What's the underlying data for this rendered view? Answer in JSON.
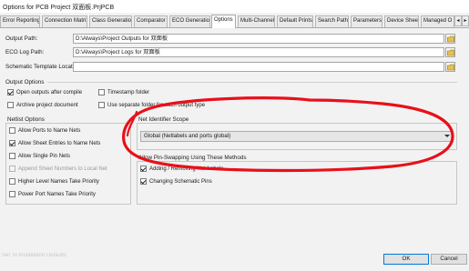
{
  "window": {
    "title": "Options for PCB Project 双面板.PrjPCB"
  },
  "tabs": [
    "Error Reporting",
    "Connection Matrix",
    "Class Generation",
    "Comparator",
    "ECO Generation",
    "Options",
    "Multi-Channel",
    "Default Prints",
    "Search Paths",
    "Parameters",
    "Device Sheets",
    "Managed O"
  ],
  "tab_scroll": {
    "left": "◂",
    "right": "▸"
  },
  "paths": {
    "output_label": "Output Path:",
    "output_value": "D:\\Always\\Project Outputs for 双面板",
    "eco_label": "ECO Log Path:",
    "eco_value": "D:\\Always\\Project Logs for 双面板",
    "template_label": "Schematic Template Location:",
    "template_value": ""
  },
  "output_options": {
    "title": "Output Options",
    "open_after_compile": {
      "label": "Open outputs after compile",
      "checked": true
    },
    "timestamp_folder": {
      "label": "Timestamp folder",
      "checked": false
    },
    "archive_document": {
      "label": "Archive project document",
      "checked": false
    },
    "separate_folder": {
      "label": "Use separate folder for each output type",
      "checked": false
    }
  },
  "netlist_options": {
    "title": "Netlist Options",
    "items": [
      {
        "label": "Allow Ports to Name Nets",
        "checked": false,
        "enabled": true
      },
      {
        "label": "Allow Sheet Entries to Name Nets",
        "checked": true,
        "enabled": true
      },
      {
        "label": "Allow Single Pin Nets",
        "checked": false,
        "enabled": true
      },
      {
        "label": "Append Sheet Numbers to Local Net",
        "checked": false,
        "enabled": false
      },
      {
        "label": "Higher Level Names Take Priority",
        "checked": false,
        "enabled": true
      },
      {
        "label": "Power Port Names Take Priority",
        "checked": false,
        "enabled": true
      }
    ]
  },
  "net_identifier": {
    "title": "Net Identifier Scope",
    "selected": "Global (Netlabels and ports global)"
  },
  "pin_swapping": {
    "title": "Allow Pin-Swapping Using These Methods",
    "adding_removing": {
      "label": "Adding / Removing Net-Labels",
      "checked": true
    },
    "changing_pins": {
      "label": "Changing Schematic Pins",
      "checked": true
    }
  },
  "footer": {
    "watermark": "Set To Installation Defaults",
    "ok": "OK",
    "cancel": "Cancel"
  },
  "annotation": {
    "color": "#e8101a"
  },
  "colors": {
    "ok_border": "#0078d7"
  }
}
